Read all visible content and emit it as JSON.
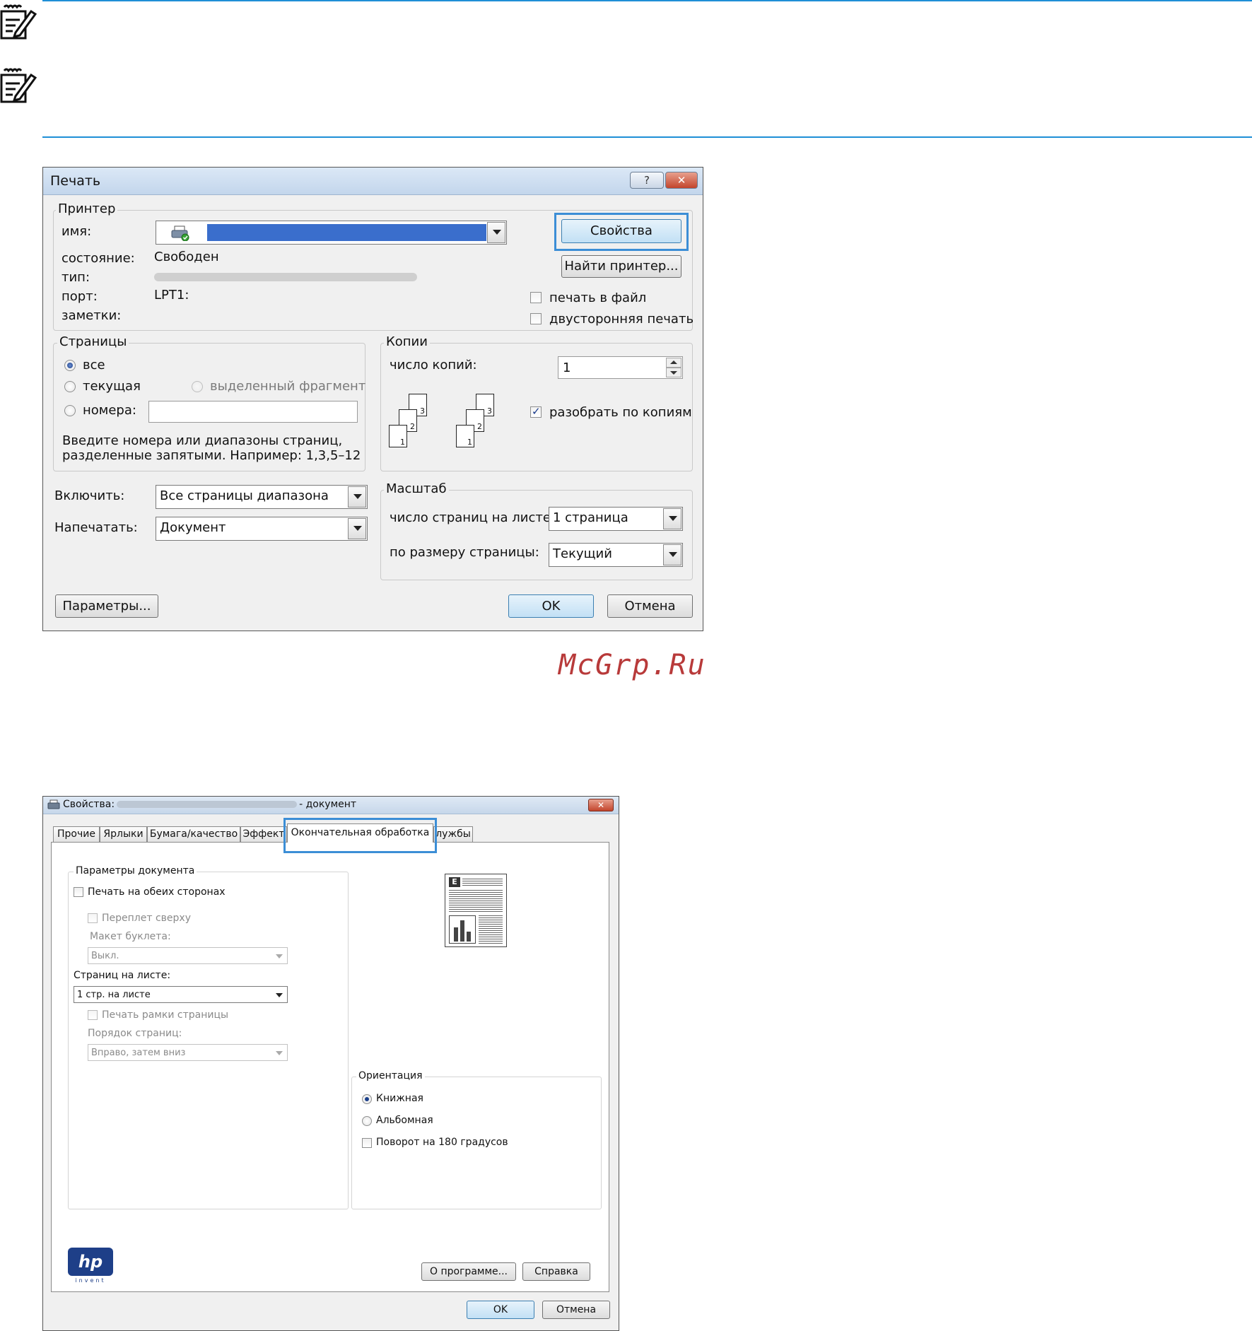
{
  "print_dialog": {
    "title": "Печать",
    "help_label": "?",
    "close_label": "✕",
    "printer": {
      "legend": "Принтер",
      "name_label": "имя:",
      "status_label": "состояние:",
      "status_value": "Свободен",
      "type_label": "тип:",
      "port_label": "порт:",
      "port_value": "LPT1:",
      "notes_label": "заметки:",
      "properties_button": "Свойства",
      "find_printer_button": "Найти принтер...",
      "print_to_file": "печать в файл",
      "duplex": "двусторонняя печать"
    },
    "pages": {
      "legend": "Страницы",
      "all": "все",
      "current": "текущая",
      "selection": "выделенный фрагмент",
      "numbers": "номера:",
      "hint_line1": "Введите номера или диапазоны страниц,",
      "hint_line2": "разделенные запятыми. Например: 1,3,5–12"
    },
    "copies": {
      "legend": "Копии",
      "count_label": "число копий:",
      "count_value": "1",
      "collate": "разобрать по копиям",
      "collate_checked": true,
      "page_numbers": [
        "3",
        "2",
        "1"
      ]
    },
    "include_label": "Включить:",
    "include_value": "Все страницы диапазона",
    "print_what_label": "Напечатать:",
    "print_what_value": "Документ",
    "zoom": {
      "legend": "Масштаб",
      "pages_per_sheet_label": "число страниц на листе:",
      "pages_per_sheet_value": "1 страница",
      "scale_label": "по размеру страницы:",
      "scale_value": "Текущий"
    },
    "options_button": "Параметры...",
    "ok_button": "OK",
    "cancel_button": "Отмена",
    "highlight_color": "#3c8ed6"
  },
  "watermark": "McGrp.Ru",
  "properties_dialog": {
    "title_prefix": "Свойства:",
    "title_suffix": "- документ",
    "tabs": [
      "Прочие",
      "Ярлыки",
      "Бумага/качество",
      "Эффект",
      "Окончательная обработка",
      "лужбы"
    ],
    "active_tab": "Окончательная обработка",
    "doc_options": {
      "legend": "Параметры документа",
      "print_both_sides": "Печать на обеих сторонах",
      "flip_up": "Переплет сверху",
      "booklet_layout_label": "Макет буклета:",
      "booklet_layout_value": "Выкл.",
      "pages_per_sheet_label": "Страниц на листе:",
      "pages_per_sheet_value": "1 стр. на листе",
      "print_page_borders": "Печать рамки страницы",
      "page_order_label": "Порядок страниц:",
      "page_order_value": "Вправо, затем вниз"
    },
    "orientation": {
      "legend": "Ориентация",
      "portrait": "Книжная",
      "landscape": "Альбомная",
      "rotate180": "Поворот на 180 градусов"
    },
    "logo_text": "hp",
    "logo_tagline": "invent",
    "about_button": "О программе...",
    "help_button": "Справка",
    "ok_button": "OK",
    "cancel_button": "Отмена"
  }
}
